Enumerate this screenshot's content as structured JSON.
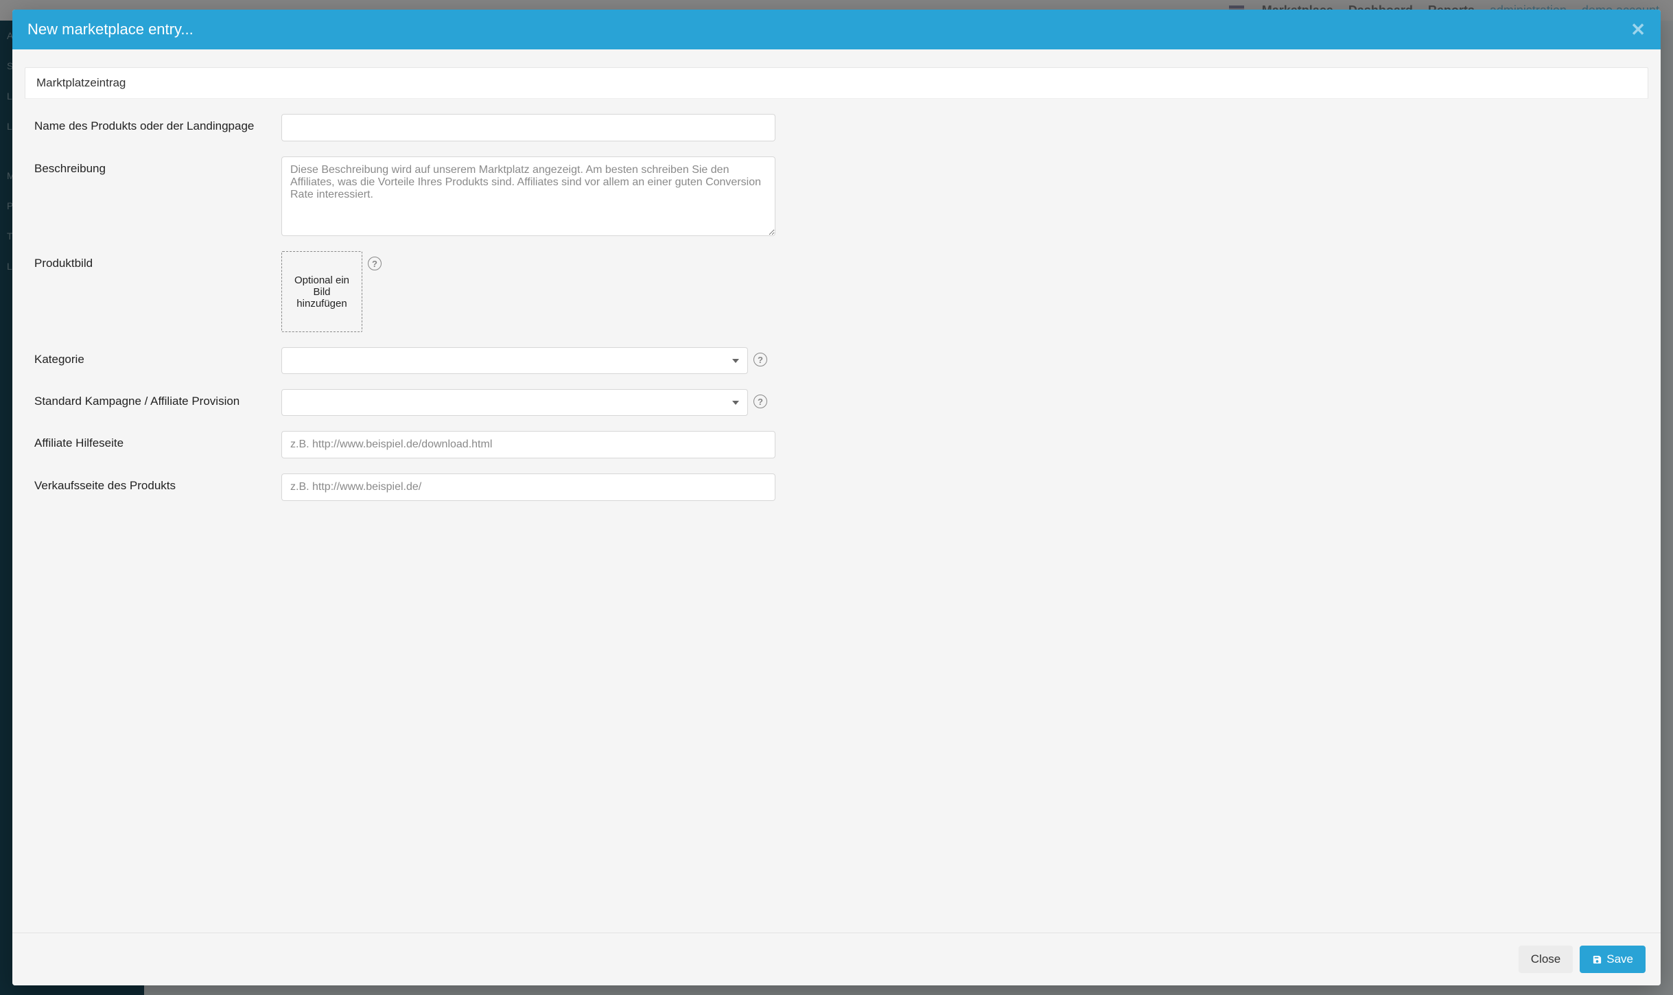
{
  "backdrop_nav": {
    "items": [
      "Marketplace",
      "Dashboard",
      "Reports",
      "administration"
    ],
    "user": "demo account"
  },
  "backdrop_sidebar": {
    "items": [
      "A",
      "S",
      "LO",
      "LA",
      "",
      "M",
      "PA",
      "TE",
      "LL"
    ]
  },
  "modal": {
    "title": "New marketplace entry...",
    "section_tab": "Marktplatzeintrag"
  },
  "form": {
    "name": {
      "label": "Name des Produkts oder der Landingpage",
      "value": ""
    },
    "description": {
      "label": "Beschreibung",
      "value": "",
      "placeholder": "Diese Beschreibung wird auf unserem Marktplatz angezeigt. Am besten schreiben Sie den Affiliates, was die Vorteile Ihres Produkts sind. Affiliates sind vor allem an einer guten Conversion Rate interessiert."
    },
    "image": {
      "label": "Produktbild",
      "drop_text": "Optional ein Bild hinzufügen"
    },
    "category": {
      "label": "Kategorie",
      "value": ""
    },
    "campaign": {
      "label": "Standard Kampagne / Affiliate Provision",
      "value": ""
    },
    "help_page": {
      "label": "Affiliate Hilfeseite",
      "placeholder": "z.B. http://www.beispiel.de/download.html",
      "value": ""
    },
    "sales_page": {
      "label": "Verkaufsseite des Produkts",
      "placeholder": "z.B. http://www.beispiel.de/",
      "value": ""
    }
  },
  "footer": {
    "close": "Close",
    "save": "Save"
  }
}
